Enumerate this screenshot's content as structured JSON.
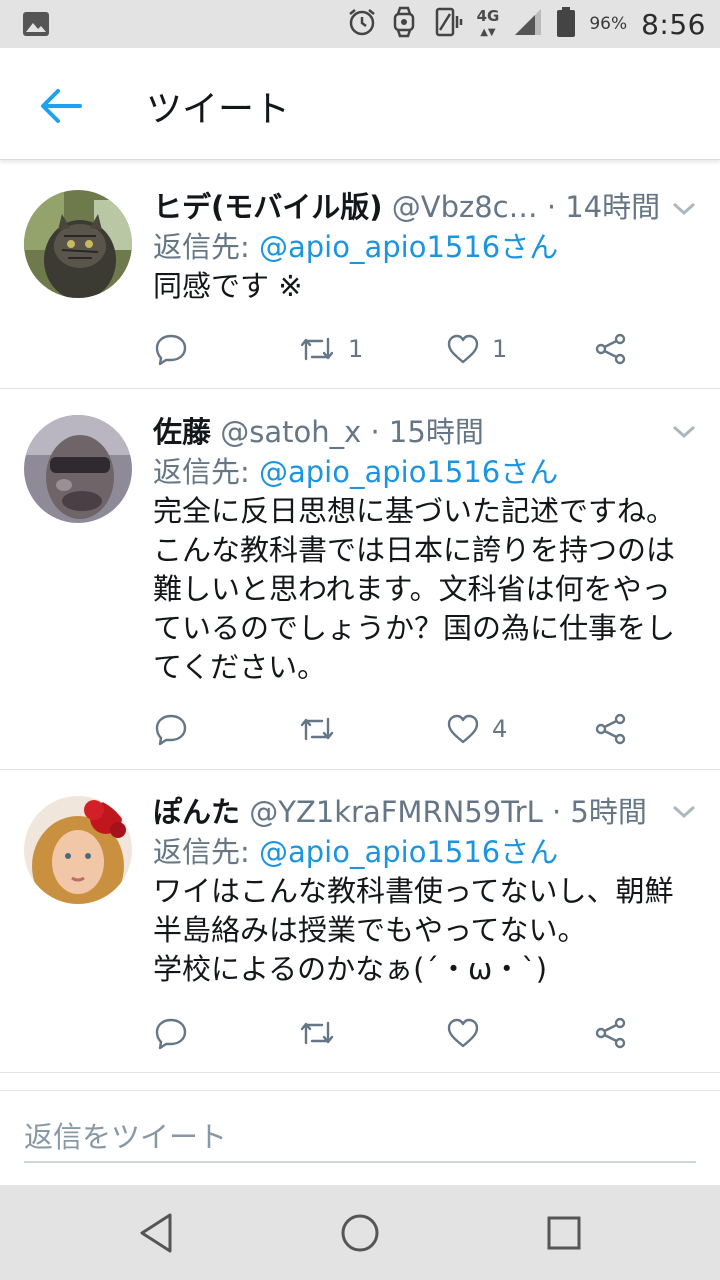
{
  "status_bar": {
    "battery": "96%",
    "time": "8:56",
    "network": "4G",
    "icons": [
      "image-icon",
      "alarm-icon",
      "watch-icon",
      "vibrate-icon",
      "signal-icon",
      "battery-icon"
    ]
  },
  "header": {
    "title": "ツイート",
    "back_icon": "back-arrow-icon"
  },
  "colors": {
    "accent": "#1da1f2",
    "mention": "#1b95e0",
    "secondary_text": "#657786",
    "primary_text": "#14171a"
  },
  "tweets": [
    {
      "name": "ヒデ(モバイル版)",
      "handle": "@Vbz8c…",
      "time": "· 14時間",
      "reply_prefix": "返信先: ",
      "reply_to": "@apio_apio1516さん",
      "text": "同感です ※",
      "retweets": "1",
      "likes": "1"
    },
    {
      "name": "佐藤",
      "handle": "@satoh_x",
      "time": "· 15時間",
      "reply_prefix": "返信先: ",
      "reply_to": "@apio_apio1516さん",
      "text": "完全に反日思想に基づいた記述ですね。\nこんな教科書では日本に誇りを持つのは\n難しいと思われます。文科省は何をやっ\nているのでしょうか？国の為に仕事をし\nてください。",
      "retweets": "",
      "likes": "4"
    },
    {
      "name": "ぽんた",
      "handle": "@YZ1kraFMRN59TrL",
      "time": "· 5時間",
      "reply_prefix": "返信先: ",
      "reply_to": "@apio_apio1516さん",
      "text": "ワイはこんな教科書使ってないし、朝鮮\n半島絡みは授業でもやってない。\n学校によるのかなぁ(´・ω・`)",
      "retweets": "",
      "likes": ""
    }
  ],
  "compose": {
    "placeholder": "返信をツイート"
  },
  "navbar": {
    "icons": [
      "nav-back-icon",
      "nav-home-icon",
      "nav-recents-icon"
    ]
  }
}
